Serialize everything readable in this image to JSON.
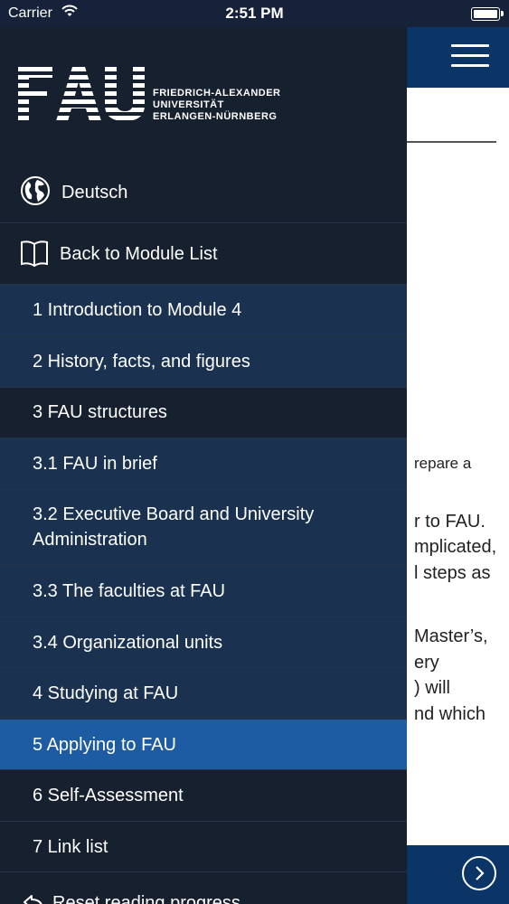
{
  "status_bar": {
    "carrier": "Carrier",
    "time": "2:51 PM"
  },
  "background_content": {
    "lines": [
      "repare a",
      "r to FAU.",
      "mplicated,",
      "l steps as",
      "Master’s,",
      "ery",
      ") will",
      "nd which"
    ]
  },
  "logo": {
    "lines": [
      "FRIEDRICH-ALEXANDER",
      "UNIVERSITÄT",
      "ERLANGEN-NÜRNBERG"
    ]
  },
  "menu": {
    "language_label": "Deutsch",
    "back_label": "Back to Module List",
    "chapters": [
      {
        "label": "1 Introduction to Module 4"
      },
      {
        "label": "2 History, facts, and figures"
      },
      {
        "label": "3 FAU structures"
      },
      {
        "label": "3.1 FAU in brief"
      },
      {
        "label": "3.2 Executive Board and University Administration"
      },
      {
        "label": "3.3 The faculties at FAU"
      },
      {
        "label": "3.4 Organizational units"
      },
      {
        "label": "4 Studying at FAU"
      },
      {
        "label": "5 Applying to FAU"
      },
      {
        "label": "6 Self-Assessment"
      },
      {
        "label": "7 Link list"
      }
    ],
    "reset_label": "Reset reading progress"
  },
  "colors": {
    "menu_bg": "#17202e",
    "chapter_bg": "#1a3150",
    "active_bg": "#1d5ba3",
    "header_bg": "#0b3467"
  }
}
